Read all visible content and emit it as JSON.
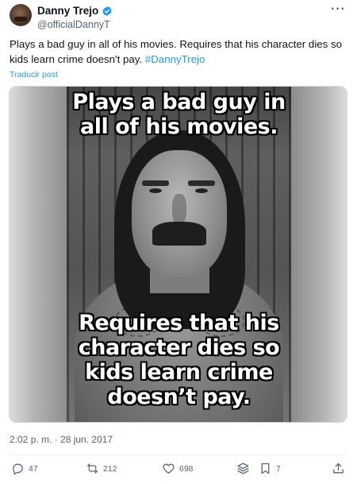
{
  "author": {
    "name": "Danny Trejo",
    "handle": "@officialDannyT",
    "verified": true
  },
  "tweet": {
    "text": "Plays a bad guy in all of his movies. Requires that his character dies so kids learn crime doesn't pay.",
    "hashtag": "#DannyTrejo",
    "translate_label": "Traducir post"
  },
  "media": {
    "top_caption": "Plays a bad guy in all of his movies.",
    "bottom_caption": "Requires that his character dies so kids learn crime doesn’t pay."
  },
  "timestamp": "2:02 p. m. · 28 jun. 2017",
  "actions": {
    "replies": "47",
    "reposts": "212",
    "likes": "698",
    "bookmarks": "7"
  },
  "colors": {
    "accent": "#1d9bf0",
    "secondary_text": "#536471"
  }
}
